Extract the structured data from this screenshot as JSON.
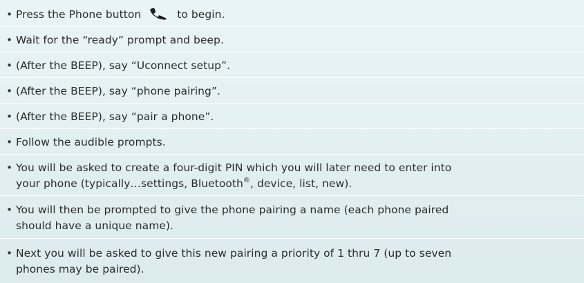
{
  "bullet": "•",
  "instructions": [
    {
      "before_icon": "Press the Phone button",
      "after_icon": "to begin.",
      "icon": "phone-handset-icon"
    },
    {
      "text": "Wait for the “ready” prompt and beep."
    },
    {
      "text": "(After the BEEP), say “Uconnect setup”."
    },
    {
      "text": "(After the BEEP), say “phone pairing”."
    },
    {
      "text": "(After the BEEP), say “pair a phone”."
    },
    {
      "text": "Follow the audible prompts."
    },
    {
      "line1": "You will be asked to create a four-digit PIN which you will later need to enter into",
      "line2_before": "your phone (typically…settings, Bluetooth",
      "line2_sup": "®",
      "line2_after": ", device, list, new)."
    },
    {
      "line1": "You will then be prompted to give the phone pairing a name (each phone paired",
      "line2": "should have a unique name)."
    },
    {
      "line1": "Next you will be asked to give this new pairing a priority of 1 thru 7 (up to seven",
      "line2": "phones may be paired)."
    }
  ],
  "colors": {
    "text": "#2b2b2b",
    "icon": "#1a1a1a",
    "background": "#e3f0f2",
    "divider": "#ffffff"
  }
}
